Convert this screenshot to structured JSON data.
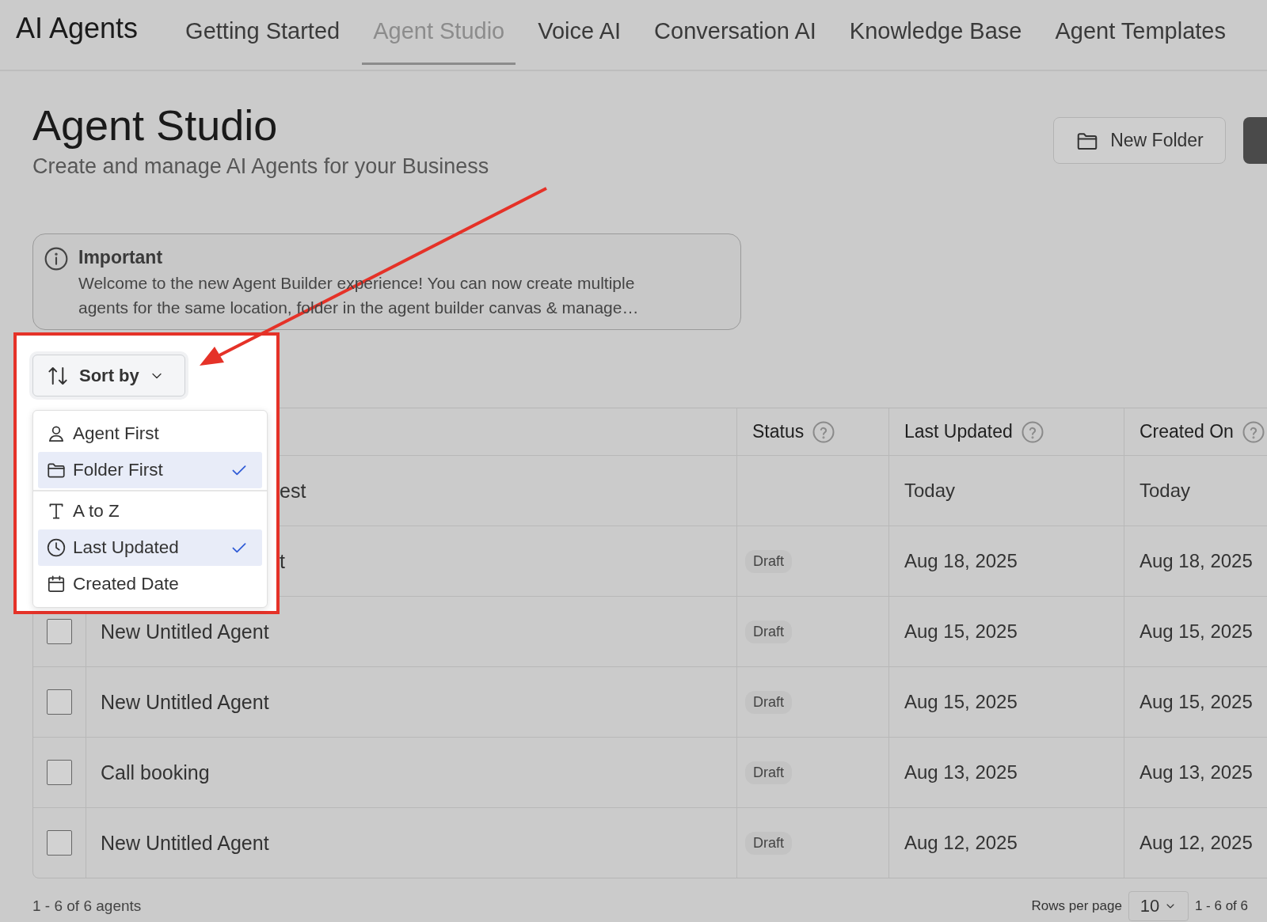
{
  "nav": {
    "logo": "AI Agents",
    "tabs": [
      {
        "label": "Getting Started",
        "selected": false
      },
      {
        "label": "Agent Studio",
        "selected": true
      },
      {
        "label": "Voice AI",
        "selected": false
      },
      {
        "label": "Conversation AI",
        "selected": false
      },
      {
        "label": "Knowledge Base",
        "selected": false
      },
      {
        "label": "Agent Templates",
        "selected": false
      }
    ]
  },
  "header": {
    "title": "Agent Studio",
    "subtitle": "Create and manage AI Agents for your Business",
    "new_folder_button": "New Folder"
  },
  "notice": {
    "title": "Important",
    "text": "Welcome to the new Agent Builder experience! You can now create multiple agents for the same location, folder in the agent builder canvas & manage…"
  },
  "sort": {
    "label": "Sort by",
    "menu_groups": [
      [
        {
          "label": "Agent First",
          "selected": false
        },
        {
          "label": "Folder First",
          "selected": true
        }
      ],
      [
        {
          "label": "A to Z",
          "selected": false
        },
        {
          "label": "Last Updated",
          "selected": true
        },
        {
          "label": "Created Date",
          "selected": false
        }
      ]
    ]
  },
  "table": {
    "columns": [
      {
        "label": "Status"
      },
      {
        "label": "Last Updated"
      },
      {
        "label": "Created On"
      }
    ],
    "rows": [
      {
        "name": "est",
        "obscured": true,
        "last_updated": "Today",
        "created_on": "Today"
      },
      {
        "name": "t",
        "obscured": true,
        "status": "Draft",
        "last_updated": "Aug 18, 2025",
        "created_on": "Aug 18, 2025"
      },
      {
        "name": "New Untitled Agent",
        "obscured": false,
        "checked": false,
        "status": "Draft",
        "last_updated": "Aug 15, 2025",
        "created_on": "Aug 15, 2025"
      },
      {
        "name": "New Untitled Agent",
        "obscured": false,
        "checked": false,
        "status": "Draft",
        "last_updated": "Aug 15, 2025",
        "created_on": "Aug 15, 2025"
      },
      {
        "name": "Call booking",
        "obscured": false,
        "checked": false,
        "status": "Draft",
        "last_updated": "Aug 13, 2025",
        "created_on": "Aug 13, 2025"
      },
      {
        "name": "New Untitled Agent",
        "obscured": false,
        "checked": false,
        "status": "Draft",
        "last_updated": "Aug 12, 2025",
        "created_on": "Aug 12, 2025"
      }
    ]
  },
  "footer": {
    "summary": "1 - 6 of 6 agents",
    "rows_per_page_label": "Rows per page",
    "rows_per_page": "10",
    "range": "1 - 6 of 6"
  }
}
